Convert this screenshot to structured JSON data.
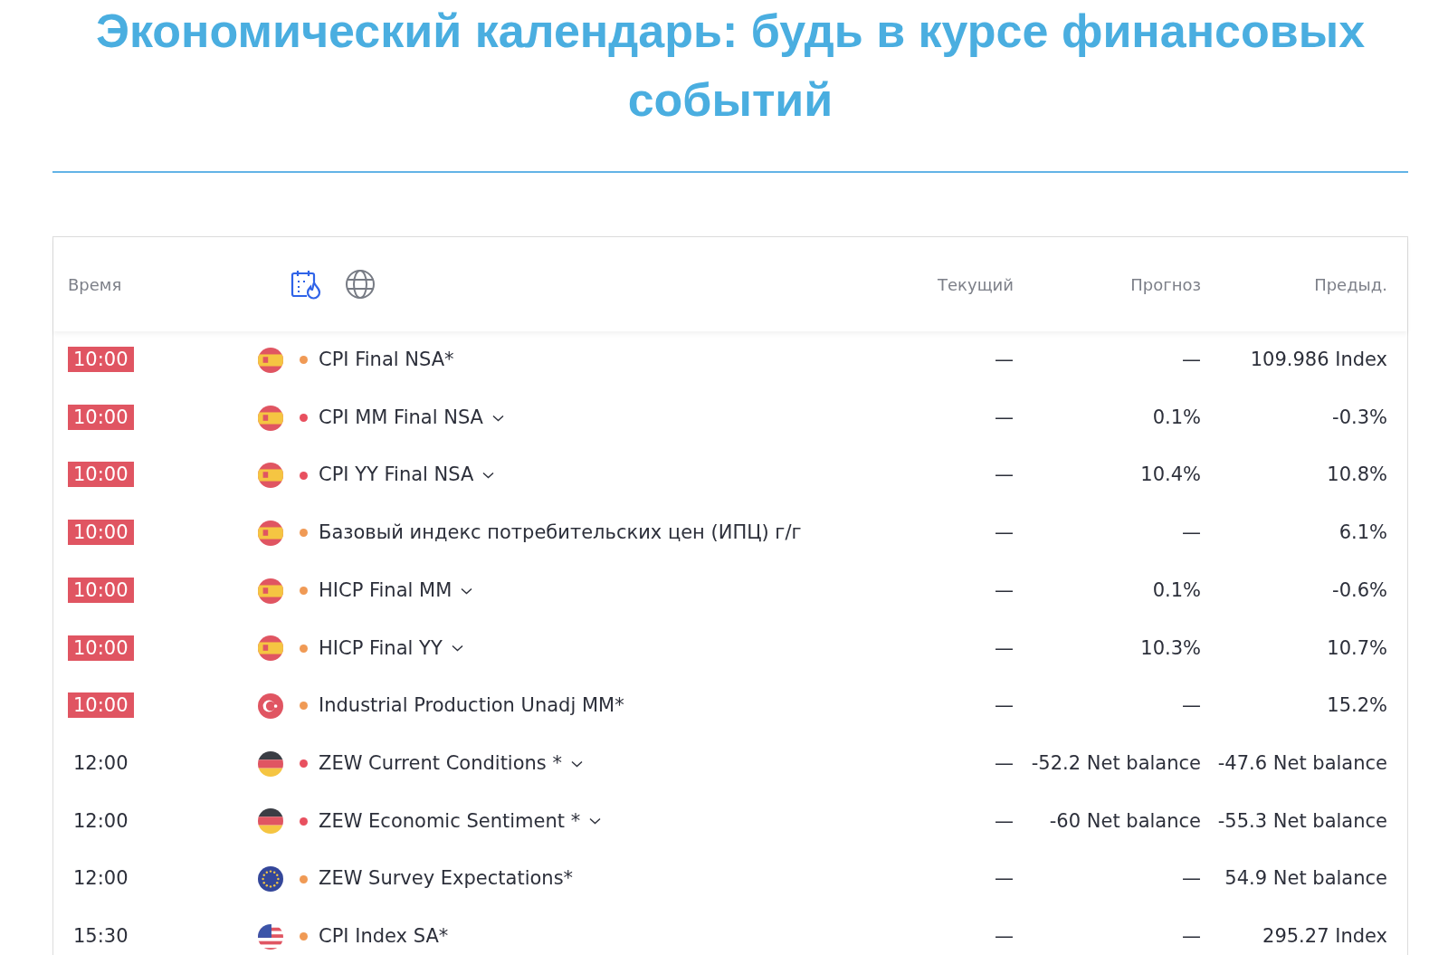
{
  "title": "Экономический календарь: будь в курсе финансовых событий",
  "columns": {
    "time": "Время",
    "current": "Текущий",
    "forecast": "Прогноз",
    "previous": "Предыд."
  },
  "rows": [
    {
      "time": "10:00",
      "highlighted": true,
      "kind": "es",
      "color": "#f09a55",
      "event": "CPI Final NSA*",
      "expandable": false,
      "current": "—",
      "forecast": "—",
      "previous": "109.986 Index"
    },
    {
      "time": "10:00",
      "highlighted": true,
      "kind": "es",
      "color": "#e8505f",
      "event": "CPI MM Final NSA",
      "expandable": true,
      "current": "—",
      "forecast": "0.1%",
      "previous": "-0.3%"
    },
    {
      "time": "10:00",
      "highlighted": true,
      "kind": "es",
      "color": "#e8505f",
      "event": "CPI YY Final NSA",
      "expandable": true,
      "current": "—",
      "forecast": "10.4%",
      "previous": "10.8%"
    },
    {
      "time": "10:00",
      "highlighted": true,
      "kind": "es",
      "color": "#f09a55",
      "event": "Базовый индекс потребительских цен (ИПЦ) г/г",
      "expandable": false,
      "current": "—",
      "forecast": "—",
      "previous": "6.1%"
    },
    {
      "time": "10:00",
      "highlighted": true,
      "kind": "es",
      "color": "#f09a55",
      "event": "HICP Final MM",
      "expandable": true,
      "current": "—",
      "forecast": "0.1%",
      "previous": "-0.6%"
    },
    {
      "time": "10:00",
      "highlighted": true,
      "kind": "es",
      "color": "#f09a55",
      "event": "HICP Final YY",
      "expandable": true,
      "current": "—",
      "forecast": "10.3%",
      "previous": "10.7%"
    },
    {
      "time": "10:00",
      "highlighted": true,
      "kind": "tr",
      "color": "#f09a55",
      "event": "Industrial Production Unadj MM*",
      "expandable": false,
      "current": "—",
      "forecast": "—",
      "previous": "15.2%"
    },
    {
      "time": "12:00",
      "highlighted": false,
      "kind": "de",
      "color": "#e8505f",
      "event": "ZEW Current Conditions *",
      "expandable": true,
      "current": "—",
      "forecast": "-52.2 Net balance",
      "previous": "-47.6 Net balance"
    },
    {
      "time": "12:00",
      "highlighted": false,
      "kind": "de",
      "color": "#e8505f",
      "event": "ZEW Economic Sentiment *",
      "expandable": true,
      "current": "—",
      "forecast": "-60 Net balance",
      "previous": "-55.3 Net balance"
    },
    {
      "time": "12:00",
      "highlighted": false,
      "kind": "eu",
      "color": "#f09a55",
      "event": "ZEW Survey Expectations*",
      "expandable": false,
      "current": "—",
      "forecast": "—",
      "previous": "54.9 Net balance"
    },
    {
      "time": "15:30",
      "highlighted": false,
      "kind": "us",
      "color": "#f09a55",
      "event": "CPI Index SA*",
      "expandable": false,
      "current": "—",
      "forecast": "—",
      "previous": "295.27 Index"
    }
  ]
}
